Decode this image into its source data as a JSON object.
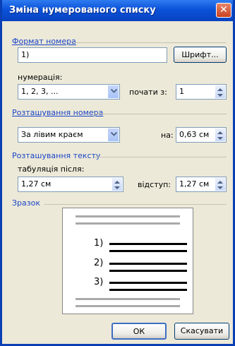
{
  "window": {
    "title": "Зміна нумерованого списку",
    "close_symbol": "✕"
  },
  "format": {
    "group_label": "Формат номера",
    "format_value": "1)",
    "font_button": "Шрифт...",
    "numbering_label": "нумерація:",
    "numbering_value": "1, 2, 3, ...",
    "start_label": "почати з:",
    "start_value": "1"
  },
  "number_position": {
    "group_label": "Розташування номера",
    "alignment_value": "За лівим краєм",
    "at_label": "на:",
    "at_value": "0,63 см"
  },
  "text_position": {
    "group_label": "Розташування тексту",
    "tab_label": "табуляція після:",
    "tab_value": "1,27 см",
    "indent_label": "відступ:",
    "indent_value": "1,27 см"
  },
  "sample": {
    "group_label": "Зразок",
    "items": [
      "1)",
      "2)",
      "3)"
    ]
  },
  "buttons": {
    "ok": "ОК",
    "cancel": "Скасувати"
  }
}
